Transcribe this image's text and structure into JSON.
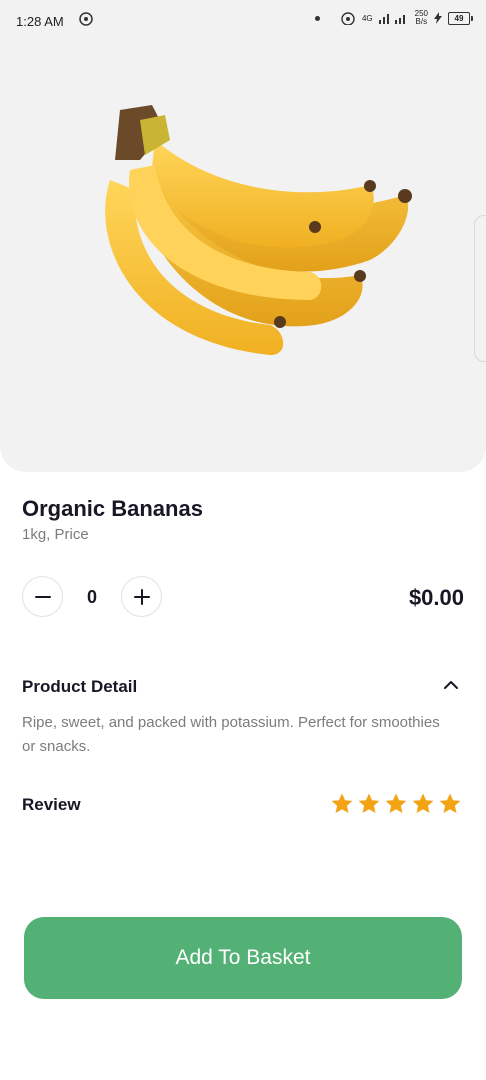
{
  "status_bar": {
    "time": "1:28 AM",
    "network_type": "4G",
    "speed_value": "250",
    "speed_unit": "B/s",
    "battery": "49"
  },
  "product": {
    "name": "Organic Bananas",
    "unit": "1kg, Price",
    "quantity": "0",
    "price": "$0.00",
    "image_icon": "bananas-image"
  },
  "detail": {
    "title": "Product Detail",
    "description": "Ripe, sweet, and packed with potassium. Perfect for smoothies or snacks."
  },
  "review": {
    "title": "Review",
    "rating": 5,
    "max_rating": 5,
    "star_color": "#f3a314"
  },
  "actions": {
    "add_to_basket": "Add To Basket"
  },
  "colors": {
    "accent": "#53b175",
    "hero_background": "#f2f2f2",
    "text_primary": "#181725",
    "text_secondary": "#7c7c7c"
  }
}
